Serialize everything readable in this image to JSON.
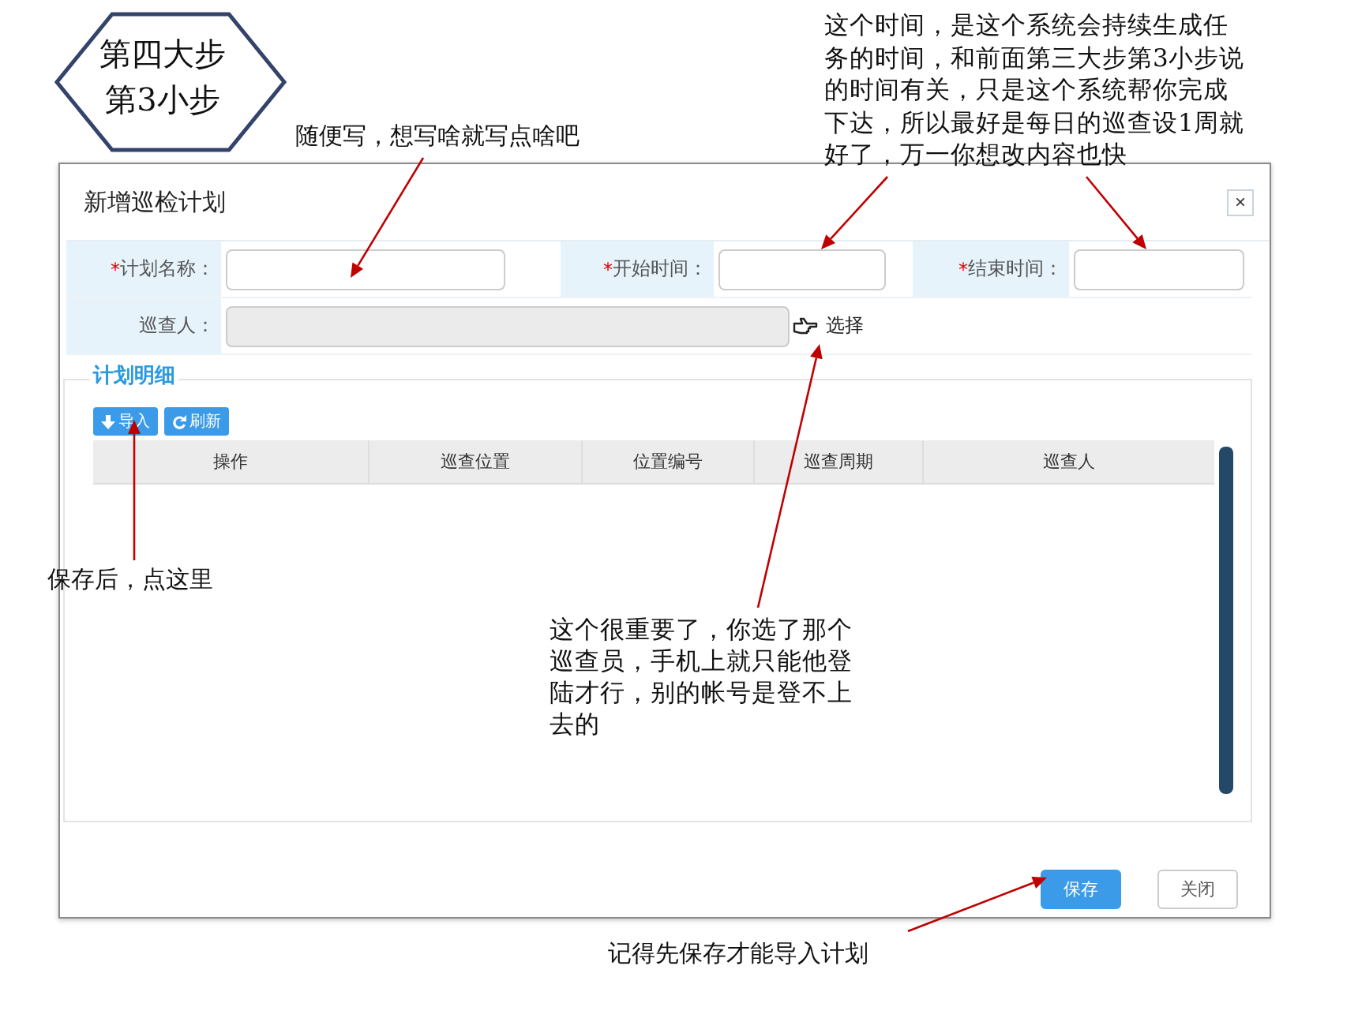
{
  "step_badge": {
    "lines": [
      "第四大步",
      "第3小步"
    ]
  },
  "dialog": {
    "title": "新增巡检计划",
    "close": "×",
    "fields": [
      {
        "label": "计划名称：",
        "required": true,
        "disabled": false
      },
      {
        "label": "开始时间：",
        "required": true,
        "disabled": false
      },
      {
        "label": "结束时间：",
        "required": true,
        "disabled": false
      },
      {
        "label": "巡查人：",
        "required": false,
        "disabled": true
      }
    ],
    "required_mark": "*",
    "select_link": "选择",
    "detail": {
      "legend": "计划明细",
      "toolbar": [
        {
          "label": "导入",
          "kind": "import"
        },
        {
          "label": "刷新",
          "kind": "refresh"
        }
      ],
      "columns": [
        "操作",
        "巡查位置",
        "位置编号",
        "巡查周期",
        "巡查人"
      ]
    },
    "buttons": [
      {
        "label": "保存",
        "kind": "primary"
      },
      {
        "label": "关闭",
        "kind": "default"
      }
    ]
  },
  "annotations": [
    {
      "lines": [
        "随便写，想写啥就写点啥吧"
      ],
      "kind": "name"
    },
    {
      "lines": [
        "这个时间，是这个系统会持续生成任",
        "务的时间，和前面第三大步第3小步说",
        "的时间有关，只是这个系统帮你完成",
        "下达，所以最好是每日的巡查设1周就",
        "好了，万一你想改内容也快"
      ],
      "kind": "time"
    },
    {
      "lines": [
        "保存后，点这里"
      ],
      "kind": "import"
    },
    {
      "lines": [
        "这个很重要了，你选了那个",
        "巡查员，手机上就只能他登",
        "陆才行，别的帐号是登不上",
        "去的"
      ],
      "kind": "inspector"
    },
    {
      "lines": [
        "记得先保存才能导入计划"
      ],
      "kind": "save"
    }
  ]
}
